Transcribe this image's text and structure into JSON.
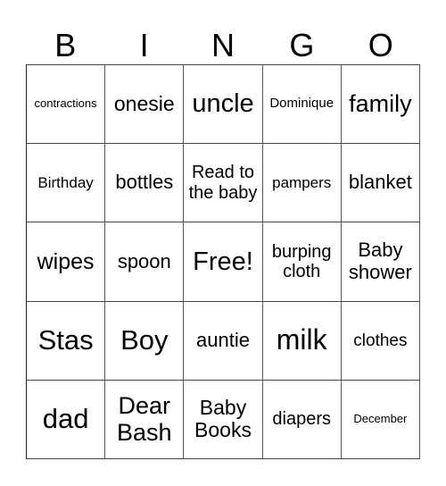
{
  "header": [
    "B",
    "I",
    "N",
    "G",
    "O"
  ],
  "cells": [
    [
      "contractions",
      "onesie",
      "uncle",
      "Dominique",
      "family"
    ],
    [
      "Birthday",
      "bottles",
      "Read to the baby",
      "pampers",
      "blanket"
    ],
    [
      "wipes",
      "spoon",
      "Free!",
      "burping cloth",
      "Baby shower"
    ],
    [
      "Stas",
      "Boy",
      "auntie",
      "milk",
      "clothes"
    ],
    [
      "dad",
      "Dear Bash",
      "Baby Books",
      "diapers",
      "December"
    ]
  ]
}
